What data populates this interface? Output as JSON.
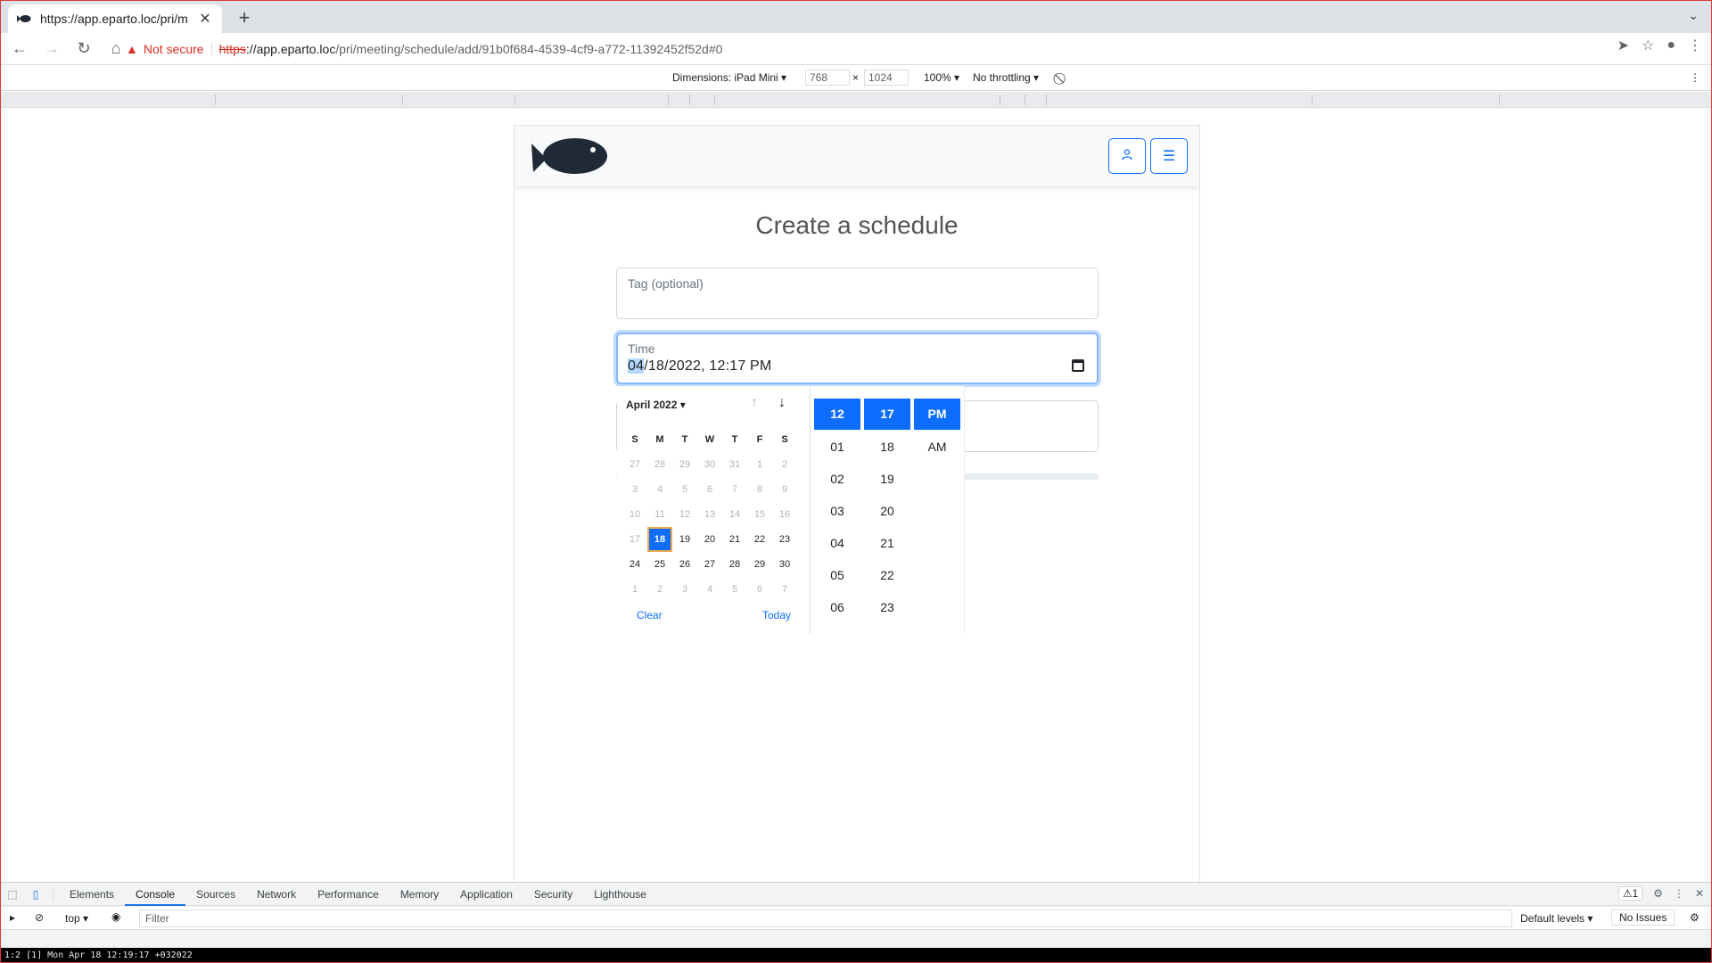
{
  "browser": {
    "tab_title": "https://app.eparto.loc/pri/m",
    "tab_close": "✕",
    "new_tab": "+",
    "security_label": "Not secure",
    "url_scheme": "https",
    "url_host": "://app.eparto.loc",
    "url_path": "/pri/meeting/schedule/add/91b0f684-4539-4cf9-a772-11392452f52d#0"
  },
  "device_toolbar": {
    "dimensions_label": "Dimensions: iPad Mini ▾",
    "width": "768",
    "times": "×",
    "height": "1024",
    "zoom": "100% ▾",
    "throttling": "No throttling ▾"
  },
  "app": {
    "page_title": "Create a schedule",
    "tag_label": "Tag (optional)",
    "time_label": "Time",
    "time_value_month": "04",
    "time_value_rest": "/18/2022, 12:17 PM"
  },
  "picker": {
    "month_label": "April 2022 ▾",
    "weekdays": [
      "S",
      "M",
      "T",
      "W",
      "T",
      "F",
      "S"
    ],
    "weeks": [
      [
        [
          "27",
          "d"
        ],
        [
          "28",
          "d"
        ],
        [
          "29",
          "d"
        ],
        [
          "30",
          "d"
        ],
        [
          "31",
          "d"
        ],
        [
          "1",
          "d"
        ],
        [
          "2",
          "d"
        ]
      ],
      [
        [
          "3",
          "d"
        ],
        [
          "4",
          "d"
        ],
        [
          "5",
          "d"
        ],
        [
          "6",
          "d"
        ],
        [
          "7",
          "d"
        ],
        [
          "8",
          "d"
        ],
        [
          "9",
          "d"
        ]
      ],
      [
        [
          "10",
          "d"
        ],
        [
          "11",
          "d"
        ],
        [
          "12",
          "d"
        ],
        [
          "13",
          "d"
        ],
        [
          "14",
          "d"
        ],
        [
          "15",
          "d"
        ],
        [
          "16",
          "d"
        ]
      ],
      [
        [
          "17",
          "d"
        ],
        [
          "18",
          "s"
        ],
        [
          "19",
          "e"
        ],
        [
          "20",
          "e"
        ],
        [
          "21",
          "e"
        ],
        [
          "22",
          "e"
        ],
        [
          "23",
          "e"
        ]
      ],
      [
        [
          "24",
          "e"
        ],
        [
          "25",
          "e"
        ],
        [
          "26",
          "e"
        ],
        [
          "27",
          "e"
        ],
        [
          "28",
          "e"
        ],
        [
          "29",
          "e"
        ],
        [
          "30",
          "e"
        ]
      ],
      [
        [
          "1",
          "d"
        ],
        [
          "2",
          "d"
        ],
        [
          "3",
          "d"
        ],
        [
          "4",
          "d"
        ],
        [
          "5",
          "d"
        ],
        [
          "6",
          "d"
        ],
        [
          "7",
          "d"
        ]
      ]
    ],
    "clear_label": "Clear",
    "today_label": "Today",
    "hours": [
      "12",
      "01",
      "02",
      "03",
      "04",
      "05",
      "06"
    ],
    "minutes": [
      "17",
      "18",
      "19",
      "20",
      "21",
      "22",
      "23"
    ],
    "meridiem": [
      "PM",
      "AM"
    ]
  },
  "devtools": {
    "tabs": [
      "Elements",
      "Console",
      "Sources",
      "Network",
      "Performance",
      "Memory",
      "Application",
      "Security",
      "Lighthouse"
    ],
    "active_tab": "Console",
    "warning_count": "⚠1",
    "context": "top ▾",
    "filter_placeholder": "Filter",
    "levels": "Default levels ▾",
    "issues": "No Issues"
  },
  "statusbar": {
    "text": "1:2 [1]    Mon Apr 18 12:19:17 +032022"
  }
}
